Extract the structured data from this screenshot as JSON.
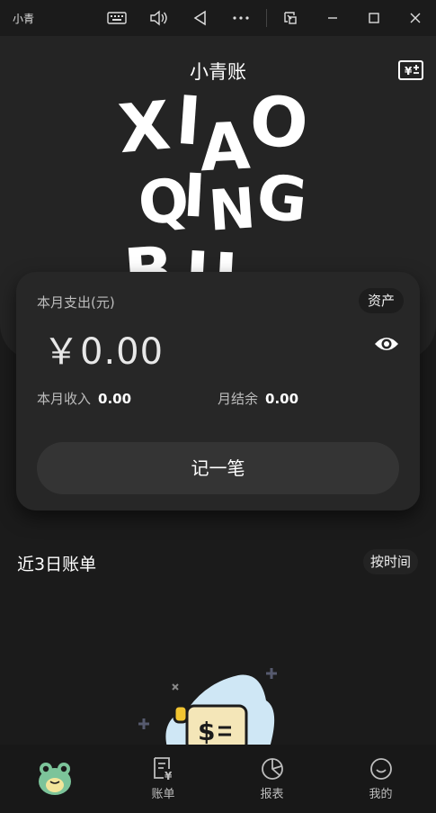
{
  "window": {
    "app_name": "小青"
  },
  "header": {
    "title": "小青账",
    "logo_lines": [
      "XIAO",
      "QING",
      "BU"
    ]
  },
  "summary": {
    "expense_label": "本月支出(元)",
    "expense_amount": "￥0.00",
    "asset_label": "资产",
    "income_label": "本月收入",
    "income_value": "0.00",
    "balance_label": "月结余",
    "balance_value": "0.00",
    "record_button": "记一笔"
  },
  "bills": {
    "title": "近3日账单",
    "sort_label": "按时间"
  },
  "tabbar": {
    "tabs": [
      {
        "label": "",
        "icon": "frog-avatar-icon"
      },
      {
        "label": "账单",
        "icon": "bill-icon"
      },
      {
        "label": "报表",
        "icon": "pie-chart-icon"
      },
      {
        "label": "我的",
        "icon": "smile-icon"
      }
    ]
  }
}
